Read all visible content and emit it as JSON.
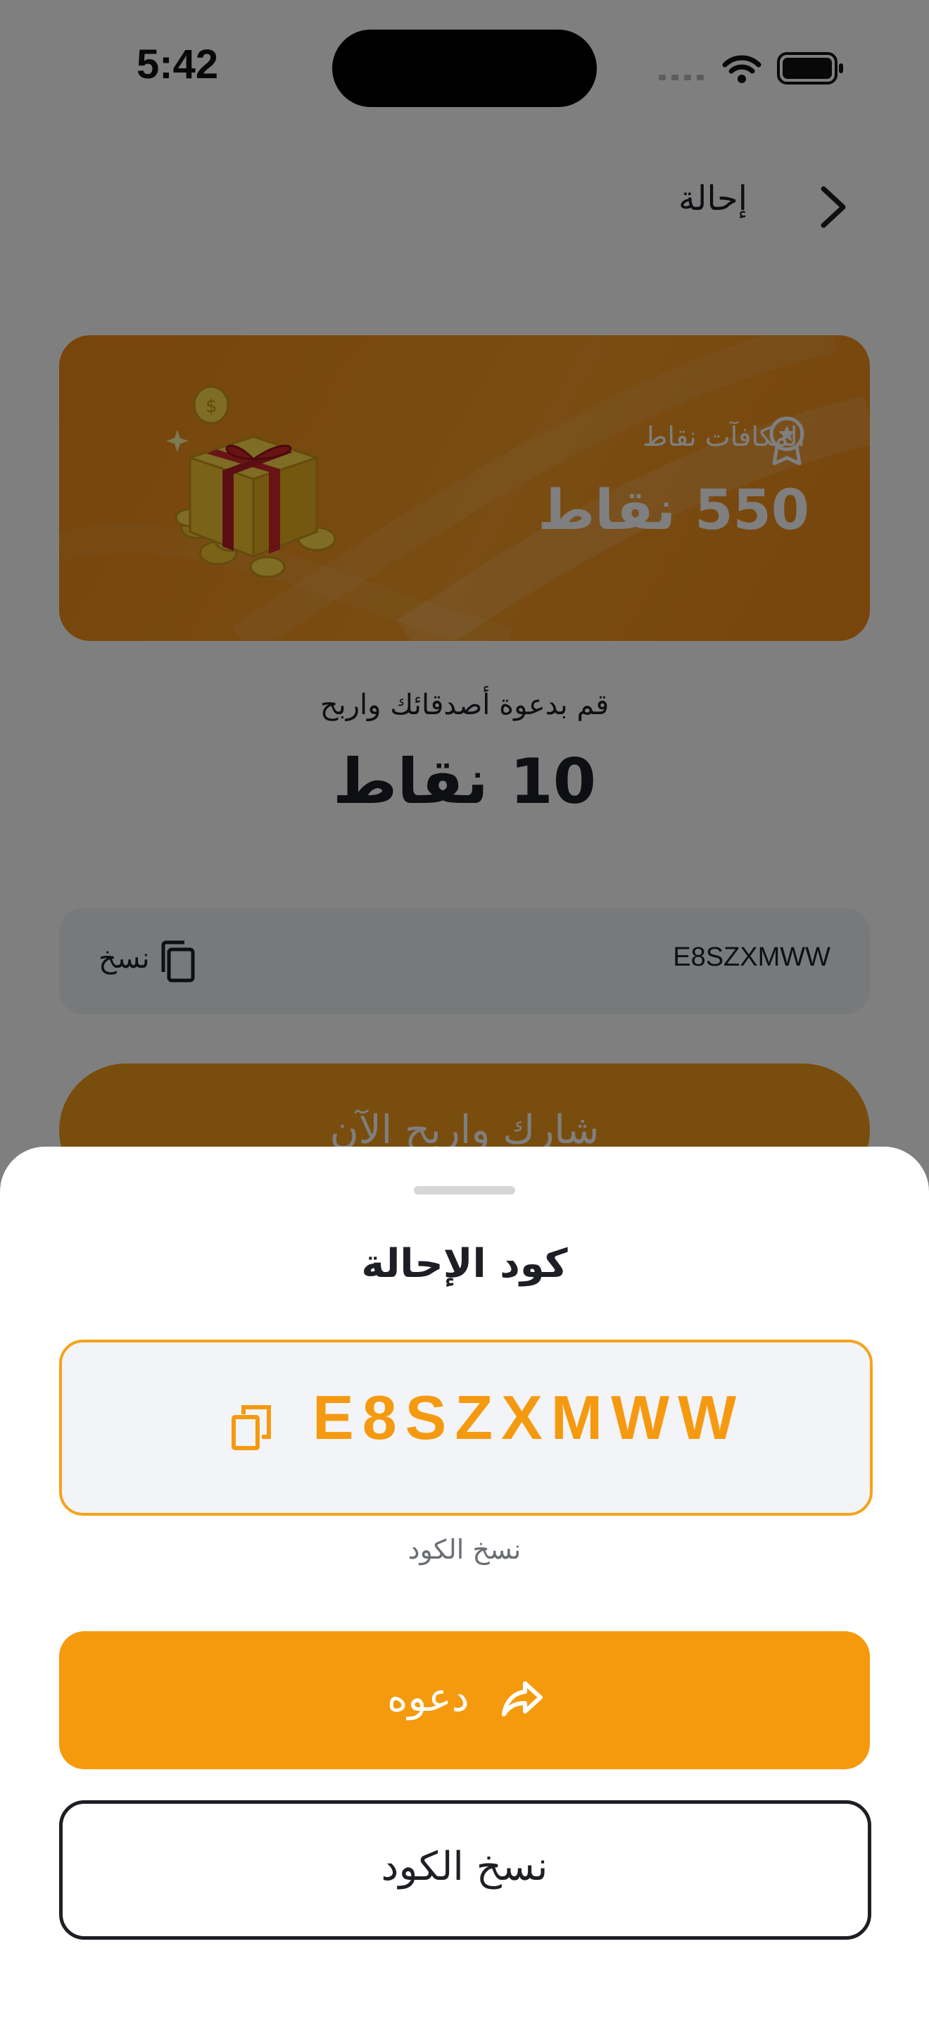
{
  "status_bar": {
    "time": "5:42"
  },
  "header": {
    "title": "إحالة",
    "back_icon": "chevron-right-icon"
  },
  "rewards_card": {
    "label": "المكافآت نقاط",
    "points": "550 نقاط",
    "accent": "#f39a1a"
  },
  "invite": {
    "text": "قم بدعوة أصدقائك واربح",
    "points": "10 نقاط"
  },
  "code_row": {
    "value": "E8SZXMWW",
    "copy_label": "نسخ"
  },
  "share_button": {
    "label": "شارك واربح الآن"
  },
  "sheet": {
    "title": "كود الإحالة",
    "code": "E8SZXMWW",
    "hint": "نسخ الكود",
    "invite_label": "دعوه",
    "copy_label": "نسخ الكود",
    "accent": "#f59a0c"
  }
}
